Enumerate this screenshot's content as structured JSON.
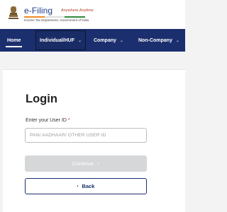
{
  "header": {
    "brand_title": "e-Filing",
    "brand_tagline": "Anywhere Anytime",
    "brand_subtitle": "Income Tax Department, Government of India",
    "emblem_icon": "national-emblem-icon",
    "colors": {
      "saffron": "#f08a24",
      "white": "#ffffff",
      "green": "#2e8b3c",
      "brand": "#1b3a8a"
    }
  },
  "nav": {
    "background": "#1b2f6e",
    "items": [
      {
        "label": "Home",
        "active": true
      },
      {
        "label": "Individual/HUF",
        "dropdown_icon": "chevron-down-icon"
      },
      {
        "label": "Company",
        "dropdown_icon": "chevron-down-icon"
      },
      {
        "label": "Non-Company",
        "dropdown_icon": "chevron-down-icon"
      }
    ]
  },
  "login": {
    "title": "Login",
    "user_id_label": "Enter your User ID",
    "required_marker": "*",
    "user_id_placeholder": "PAN/ AADHAAR/ OTHER USER ID",
    "user_id_value": "",
    "continue_label": "Continue",
    "continue_icon": "chevron-right-icon",
    "back_label": "Back",
    "back_icon": "chevron-left-icon"
  }
}
